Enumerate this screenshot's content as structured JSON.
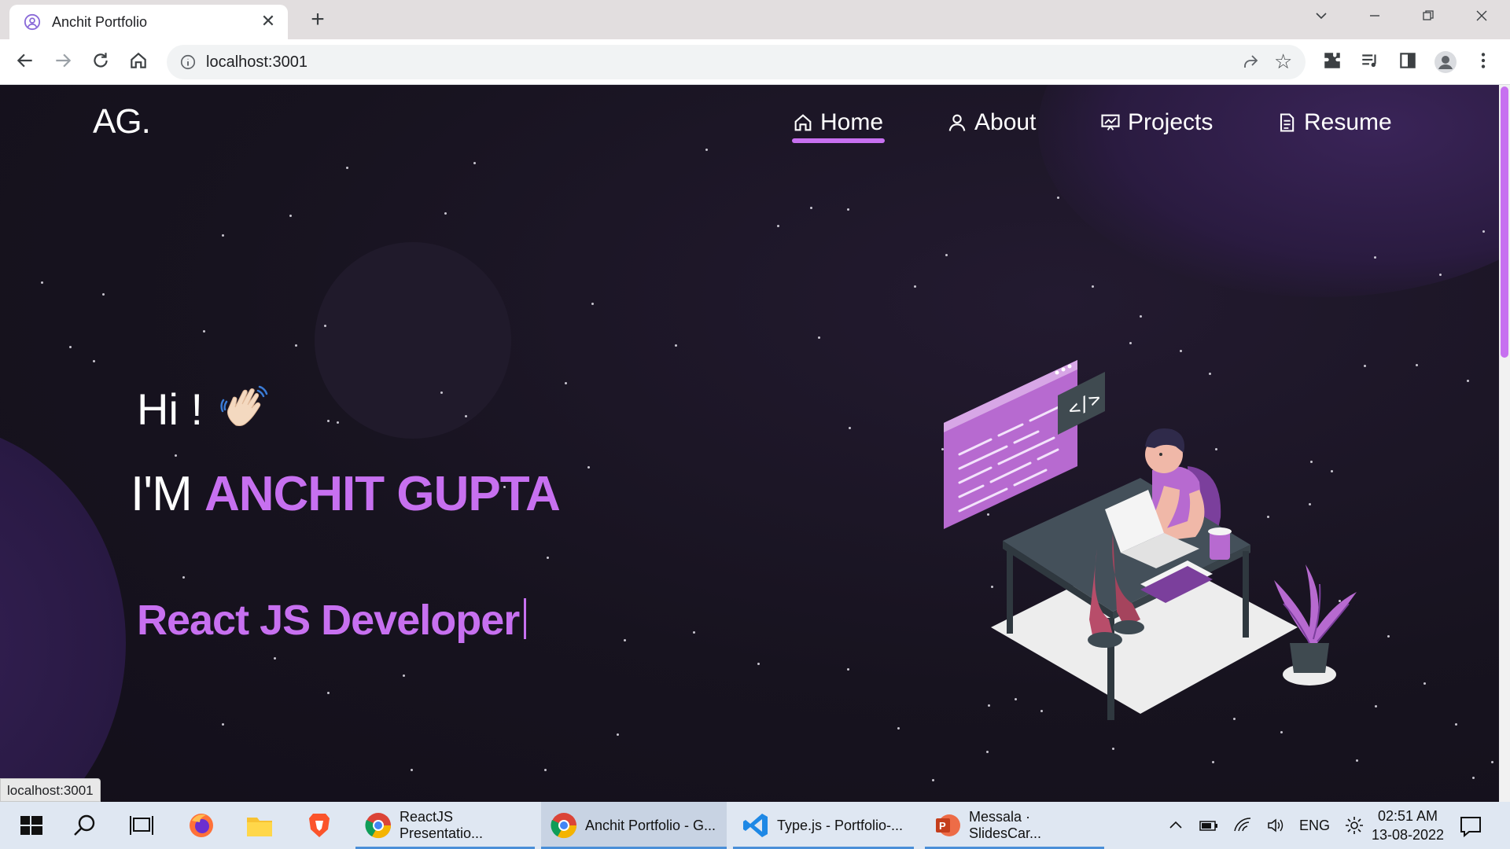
{
  "browser": {
    "tab_title": "Anchit Portfolio",
    "tab_close": "✕",
    "new_tab": "+",
    "url": "localhost:3001",
    "status_url": "localhost:3001"
  },
  "site": {
    "logo": "AG.",
    "nav": [
      {
        "label": "Home",
        "icon": "home-icon"
      },
      {
        "label": "About",
        "icon": "user-icon"
      },
      {
        "label": "Projects",
        "icon": "presentation-icon"
      },
      {
        "label": "Resume",
        "icon": "document-icon"
      }
    ],
    "active_nav": "Home",
    "greeting": "Hi !",
    "intro_prefix": "I'M",
    "name": "ANCHIT GUPTA",
    "role": "React JS Developer",
    "accent_color": "#c770f0"
  },
  "taskbar": {
    "apps": [
      {
        "label": "ReactJS Presentatio...",
        "icon": "chrome-icon"
      },
      {
        "label": "Anchit Portfolio - G...",
        "icon": "chrome-icon"
      },
      {
        "label": "Type.js - Portfolio-...",
        "icon": "vscode-icon"
      },
      {
        "label": "Messala · SlidesCar...",
        "icon": "powerpoint-icon"
      }
    ],
    "language": "ENG",
    "time": "02:51 AM",
    "date": "13-08-2022"
  }
}
